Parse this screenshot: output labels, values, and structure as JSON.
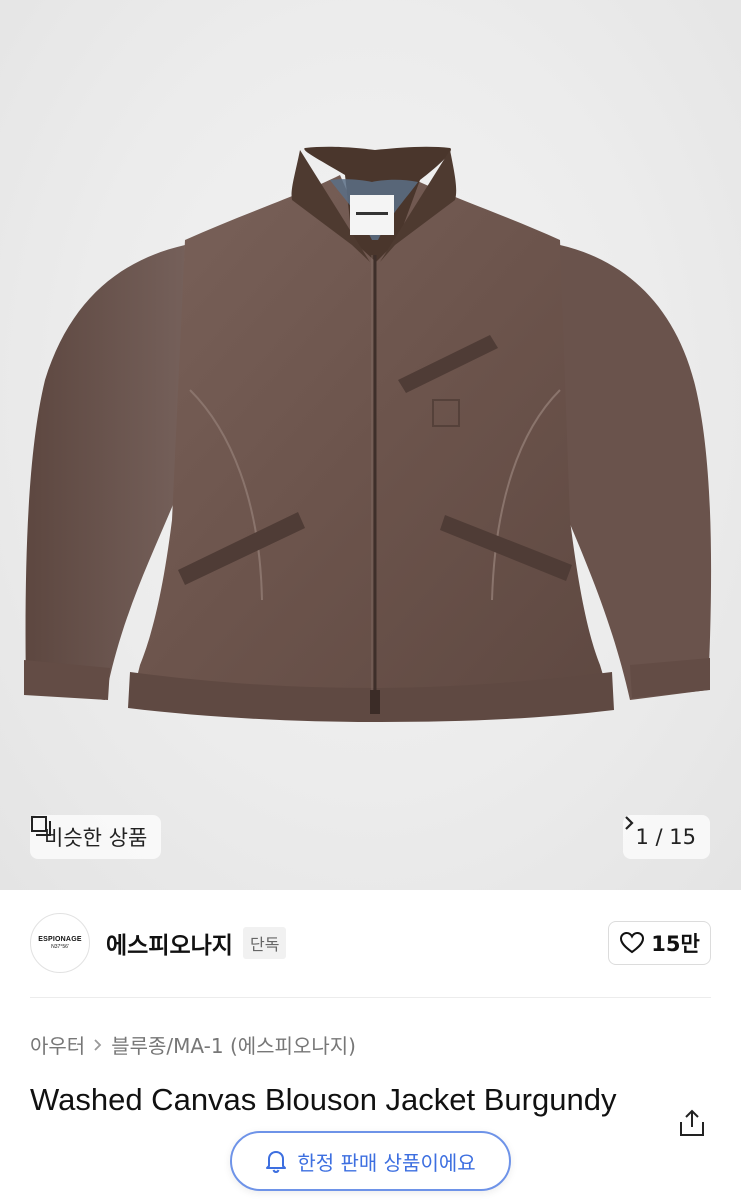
{
  "gallery": {
    "image_alt": "Washed canvas blouson jacket product photo",
    "similar_label": "비슷한 상품",
    "counter": "1 / 15"
  },
  "brand": {
    "logo_line1": "ESPIONAGE",
    "logo_line2": "N37°56'",
    "name": "에스피오나지",
    "badge": "단독",
    "likes": "15만"
  },
  "category": {
    "level1": "아우터",
    "level2": "블루종/MA-1 (에스피오나지)"
  },
  "product": {
    "title": "Washed Canvas Blouson Jacket Burgundy"
  },
  "banner": {
    "limited_label": "한정 판매 상품이에요"
  },
  "colors": {
    "jacket": "#6f5750",
    "collar": "#4a362c",
    "accent_blue": "#3d6fe0"
  }
}
